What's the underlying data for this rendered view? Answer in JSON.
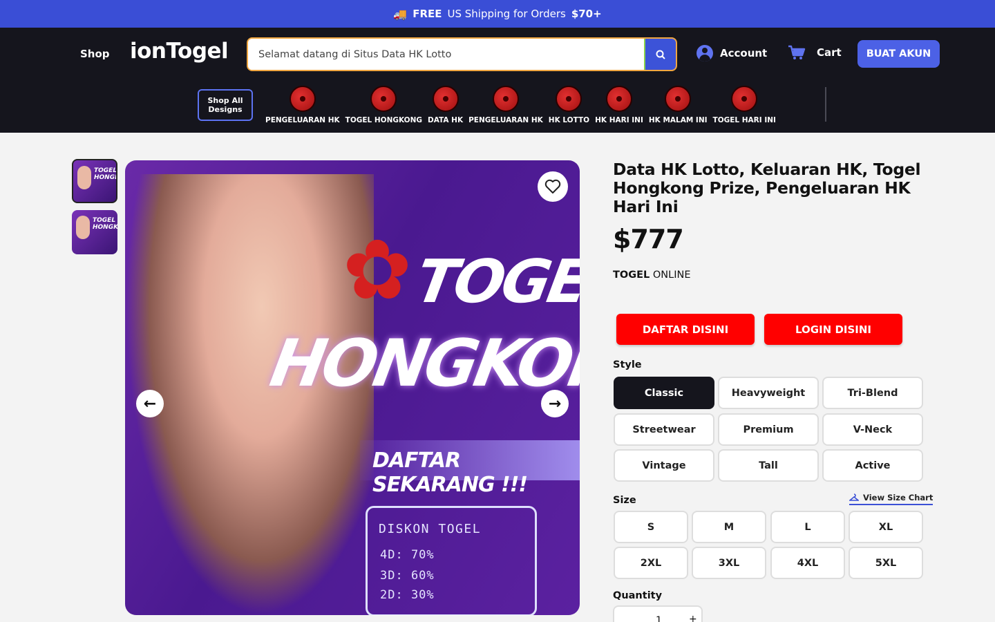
{
  "promo": {
    "strong": "FREE",
    "rest": "US Shipping for Orders",
    "amount": "$70+",
    "icon": "truck-icon"
  },
  "header": {
    "shop_label": "Shop",
    "logo": "ionTogel",
    "search_value": "Selamat datang di Situs Data HK Lotto",
    "account_label": "Account",
    "cart_label": "Cart",
    "cta_label": "BUAT AKUN"
  },
  "nav": {
    "shop_all": "Shop All Designs",
    "categories": [
      {
        "label": "PENGELUARAN HK"
      },
      {
        "label": "TOGEL HONGKONG"
      },
      {
        "label": "DATA HK"
      },
      {
        "label": "PENGELUARAN HK"
      },
      {
        "label": "HK LOTTO"
      },
      {
        "label": "HK HARI INI"
      },
      {
        "label": "HK MALAM INI"
      },
      {
        "label": "TOGEL HARI INI"
      }
    ]
  },
  "gallery": {
    "thumb_text": "TOGEL HONGKONG",
    "hero": {
      "line1": "TOGEL",
      "line2": "HONGKONG",
      "banner": "DAFTAR SEKARANG !!!",
      "box_title": "DISKON TOGEL",
      "box_lines": [
        "4D: 70%",
        "3D: 60%",
        "2D: 30%"
      ]
    }
  },
  "product": {
    "title": "Data HK Lotto, Keluaran HK, Togel Hongkong Prize, Pengeluaran HK Hari Ini",
    "price": "$777",
    "brand_strong": "TOGEL",
    "brand_rest": "ONLINE",
    "btn_register": "DAFTAR DISINI",
    "btn_login": "LOGIN DISINI",
    "style_label": "Style",
    "styles": [
      "Classic",
      "Heavyweight",
      "Tri-Blend",
      "Streetwear",
      "Premium",
      "V-Neck",
      "Vintage",
      "Tall",
      "Active"
    ],
    "selected_style": "Classic",
    "size_label": "Size",
    "size_chart_label": "View Size Chart",
    "sizes": [
      "S",
      "M",
      "L",
      "XL",
      "2XL",
      "3XL",
      "4XL",
      "5XL"
    ],
    "quantity_label": "Quantity",
    "quantity_value": "1",
    "quantity_plus": "+"
  },
  "colors": {
    "promo_bg": "#3a4ed6",
    "header_bg": "#15151d",
    "accent": "#4c61e6",
    "red": "#ff0000"
  }
}
